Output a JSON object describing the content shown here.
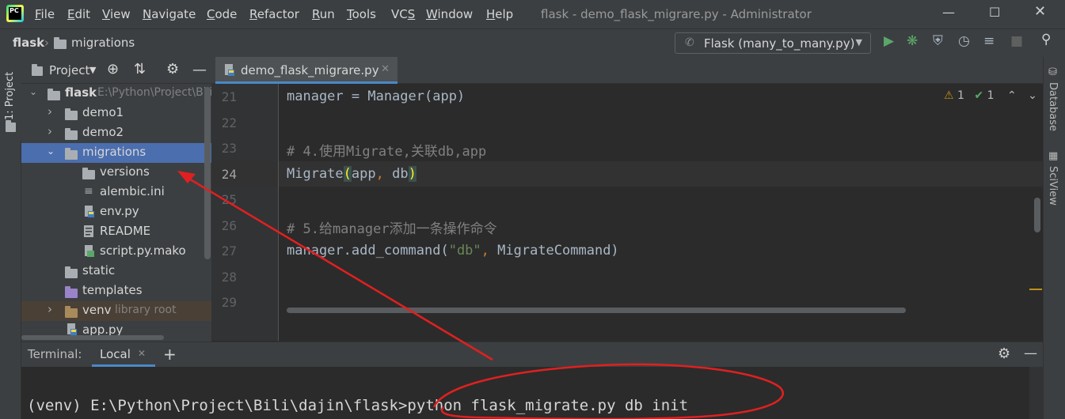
{
  "menu": {
    "items": [
      "File",
      "Edit",
      "View",
      "Navigate",
      "Code",
      "Refactor",
      "Run",
      "Tools",
      "VCS",
      "Window",
      "Help"
    ],
    "mnemonics": [
      "F",
      "E",
      "V",
      "N",
      "C",
      "R",
      "R",
      "T",
      "S",
      "W",
      "H"
    ]
  },
  "window": {
    "title": "flask - demo_flask_migrare.py - Administrator"
  },
  "breadcrumb": {
    "root": "flask",
    "child": "migrations"
  },
  "run_config": {
    "label": "Flask (many_to_many.py)"
  },
  "left_strip": {
    "project_tab": "1: Project"
  },
  "project_panel": {
    "title": "Project",
    "tree": [
      {
        "label": "flask",
        "hint": "E:\\Python\\Project\\Bili\\dajin\\flask",
        "kind": "folder",
        "depth": 0,
        "expanded": true
      },
      {
        "label": "demo1",
        "kind": "folder",
        "depth": 1,
        "expanded": false
      },
      {
        "label": "demo2",
        "kind": "folder",
        "depth": 1,
        "expanded": false
      },
      {
        "label": "migrations",
        "kind": "folder",
        "depth": 1,
        "expanded": true,
        "selected": true
      },
      {
        "label": "versions",
        "kind": "folder",
        "depth": 2
      },
      {
        "label": "alembic.ini",
        "kind": "ini",
        "depth": 2
      },
      {
        "label": "env.py",
        "kind": "python",
        "depth": 2
      },
      {
        "label": "README",
        "kind": "text",
        "depth": 2
      },
      {
        "label": "script.py.mako",
        "kind": "mako",
        "depth": 2
      },
      {
        "label": "static",
        "kind": "folder",
        "depth": 1
      },
      {
        "label": "templates",
        "kind": "folder-purple",
        "depth": 1
      },
      {
        "label": "venv",
        "hint": "library root",
        "kind": "folder-brown",
        "depth": 1,
        "expanded": false
      },
      {
        "label": "app.py",
        "kind": "python",
        "depth": 1
      }
    ]
  },
  "editor": {
    "tab": "demo_flask_migrare.py",
    "warnings": "1",
    "ok": "1",
    "lines": [
      {
        "num": "21",
        "text": "manager = Manager(app)"
      },
      {
        "num": "22",
        "text": ""
      },
      {
        "num": "23",
        "text": "# 4.使用Migrate,关联db,app"
      },
      {
        "num": "24",
        "text": "Migrate(app, db)"
      },
      {
        "num": "25",
        "text": ""
      },
      {
        "num": "26",
        "text": "# 5.给manager添加一条操作命令"
      },
      {
        "num": "27",
        "text": "manager.add_command(\"db\", MigrateCommand)"
      },
      {
        "num": "28",
        "text": ""
      },
      {
        "num": "29",
        "text": ""
      }
    ]
  },
  "right_strip": {
    "database": "Database",
    "sciview": "SciView"
  },
  "terminal": {
    "label": "Terminal:",
    "tab": "Local",
    "command_line": "(venv) E:\\Python\\Project\\Bili\\dajin\\flask>python flask_migrate.py db init"
  },
  "colors": {
    "accent": "#4a88c7",
    "selection": "#4b6eaf",
    "annotation": "#e02020"
  }
}
